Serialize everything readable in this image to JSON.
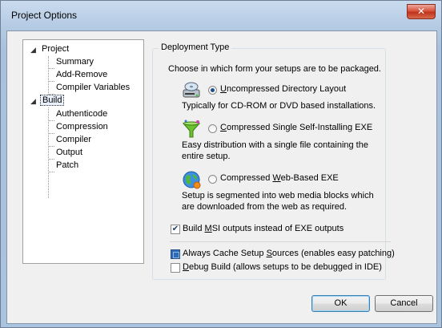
{
  "window": {
    "title": "Project Options",
    "close_glyph": "✕"
  },
  "tree": {
    "project": "Project",
    "project_children": [
      "Summary",
      "Add-Remove",
      "Compiler Variables"
    ],
    "build": "Build",
    "build_children": [
      "Authenticode",
      "Compression",
      "Compiler",
      "Output",
      "Patch"
    ]
  },
  "deployment": {
    "group_title": "Deployment Type",
    "intro": "Choose in which form your setups are to be packaged.",
    "options": [
      {
        "label_pre": "",
        "label_u": "U",
        "label_post": "ncompressed Directory Layout",
        "description": "Typically for CD-ROM or DVD based installations.",
        "selected": true,
        "icon": "disk-drive-icon"
      },
      {
        "label_pre": "",
        "label_u": "C",
        "label_post": "ompressed Single Self-Installing EXE",
        "description": "Easy distribution with a single file containing the entire setup.",
        "selected": false,
        "icon": "funnel-icon"
      },
      {
        "label_pre": "Compressed ",
        "label_u": "W",
        "label_post": "eb-Based EXE",
        "description": "Setup is segmented into web media blocks which are downloaded from the web as required.",
        "selected": false,
        "icon": "globe-icon"
      }
    ],
    "build_msi": {
      "pre": "Build ",
      "u": "M",
      "post": "SI outputs instead of EXE outputs",
      "checked": true
    },
    "cache_sources": {
      "pre": "Always Cache Setup ",
      "u": "S",
      "post": "ources (enables easy patching)",
      "checked": "indeterminate"
    },
    "debug_build": {
      "pre": "",
      "u": "D",
      "post": "ebug Build (allows setups to be debugged in IDE)",
      "checked": false
    }
  },
  "buttons": {
    "ok": "OK",
    "cancel": "Cancel"
  },
  "colors": {
    "accent": "#2d6ab7",
    "close": "#c0331d"
  }
}
